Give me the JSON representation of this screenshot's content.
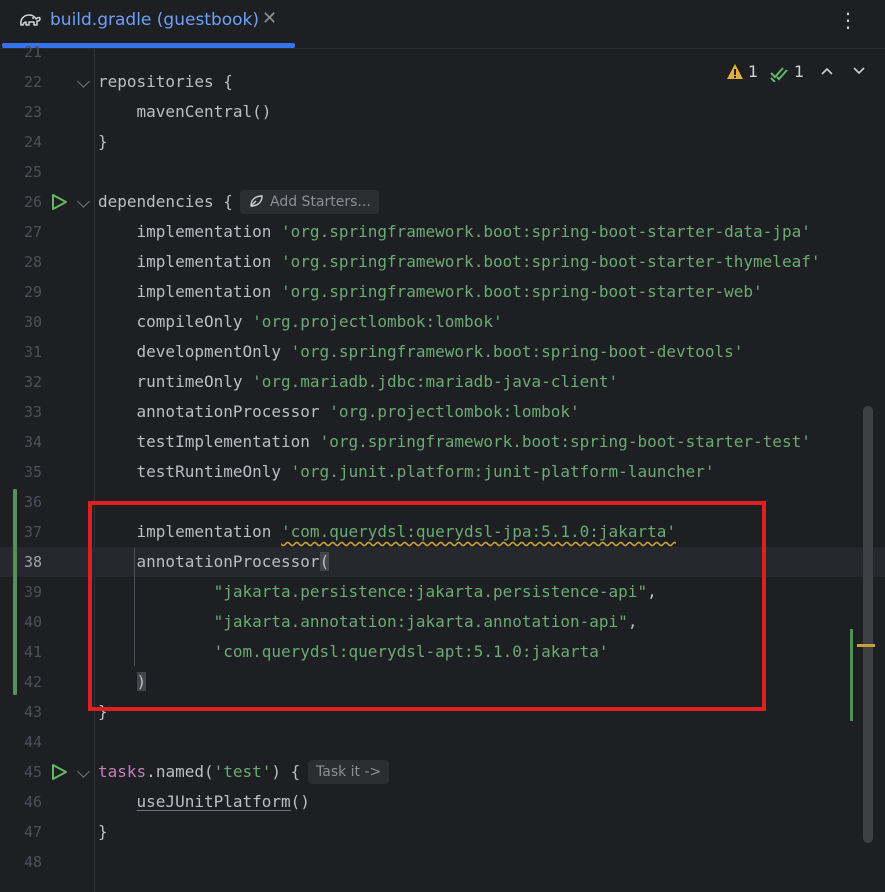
{
  "tab": {
    "label": "build.gradle (guestbook)",
    "close": "✕",
    "icon": "gradle-elephant-icon"
  },
  "kebab": "⋮",
  "inspection": {
    "warnings": "1",
    "ok": "1"
  },
  "hints": {
    "add_starters": "Add Starters...",
    "task_it": "Task it ->"
  },
  "lines": [
    {
      "n": "21",
      "parts": []
    },
    {
      "n": "22",
      "parts": [
        [
          "kw",
          "repositories {"
        ]
      ]
    },
    {
      "n": "23",
      "parts": [
        [
          "kw",
          "    mavenCentral()"
        ]
      ]
    },
    {
      "n": "24",
      "parts": [
        [
          "kw",
          "}"
        ]
      ]
    },
    {
      "n": "25",
      "parts": []
    },
    {
      "n": "26",
      "parts": [
        [
          "kw",
          "dependencies {"
        ]
      ]
    },
    {
      "n": "27",
      "parts": [
        [
          "kw",
          "    implementation "
        ],
        [
          "str",
          "'org.springframework.boot:spring-boot-starter-data-jpa'"
        ]
      ]
    },
    {
      "n": "28",
      "parts": [
        [
          "kw",
          "    implementation "
        ],
        [
          "str",
          "'org.springframework.boot:spring-boot-starter-thymeleaf'"
        ]
      ]
    },
    {
      "n": "29",
      "parts": [
        [
          "kw",
          "    implementation "
        ],
        [
          "str",
          "'org.springframework.boot:spring-boot-starter-web'"
        ]
      ]
    },
    {
      "n": "30",
      "parts": [
        [
          "kw",
          "    compileOnly "
        ],
        [
          "str",
          "'org.projectlombok:lombok'"
        ]
      ]
    },
    {
      "n": "31",
      "parts": [
        [
          "kw",
          "    developmentOnly "
        ],
        [
          "str",
          "'org.springframework.boot:spring-boot-devtools'"
        ]
      ]
    },
    {
      "n": "32",
      "parts": [
        [
          "kw",
          "    runtimeOnly "
        ],
        [
          "str",
          "'org.mariadb.jdbc:mariadb-java-client'"
        ]
      ]
    },
    {
      "n": "33",
      "parts": [
        [
          "kw",
          "    annotationProcessor "
        ],
        [
          "str",
          "'org.projectlombok:lombok'"
        ]
      ]
    },
    {
      "n": "34",
      "parts": [
        [
          "kw",
          "    testImplementation "
        ],
        [
          "str",
          "'org.springframework.boot:spring-boot-starter-test'"
        ]
      ]
    },
    {
      "n": "35",
      "parts": [
        [
          "kw",
          "    testRuntimeOnly "
        ],
        [
          "str",
          "'org.junit.platform:junit-platform-launcher'"
        ]
      ]
    },
    {
      "n": "36",
      "parts": []
    },
    {
      "n": "37",
      "parts": [
        [
          "kw",
          "    implementation "
        ],
        [
          "str warn",
          "'com.querydsl:querydsl-jpa:5.1.0:jakarta'"
        ]
      ]
    },
    {
      "n": "38",
      "parts": [
        [
          "kw",
          "    annotationProcessor"
        ],
        [
          "kw paren-hl",
          "("
        ]
      ]
    },
    {
      "n": "39",
      "parts": [
        [
          "kw",
          "            "
        ],
        [
          "str",
          "\"jakarta.persistence:jakarta.persistence-api\""
        ],
        [
          "kw",
          ","
        ]
      ]
    },
    {
      "n": "40",
      "parts": [
        [
          "kw",
          "            "
        ],
        [
          "str",
          "\"jakarta.annotation:jakarta.annotation-api\""
        ],
        [
          "kw",
          ","
        ]
      ]
    },
    {
      "n": "41",
      "parts": [
        [
          "kw",
          "            "
        ],
        [
          "str",
          "'com.querydsl:querydsl-apt:5.1.0:jakarta'"
        ]
      ]
    },
    {
      "n": "42",
      "parts": [
        [
          "kw",
          "    "
        ],
        [
          "kw paren-hl",
          ")"
        ]
      ]
    },
    {
      "n": "43",
      "parts": [
        [
          "kw",
          "}"
        ]
      ]
    },
    {
      "n": "44",
      "parts": []
    },
    {
      "n": "45",
      "parts": [
        [
          "fnkw",
          "tasks"
        ],
        [
          "kw",
          "."
        ],
        [
          "kw",
          "named("
        ],
        [
          "str",
          "'test'"
        ],
        [
          "kw",
          ") {"
        ]
      ]
    },
    {
      "n": "46",
      "parts": [
        [
          "kw",
          "    "
        ],
        [
          "fnu",
          "useJUnitPlatform"
        ],
        [
          "kw",
          "()"
        ]
      ]
    },
    {
      "n": "47",
      "parts": [
        [
          "kw",
          "}"
        ]
      ]
    },
    {
      "n": "48",
      "parts": []
    }
  ]
}
